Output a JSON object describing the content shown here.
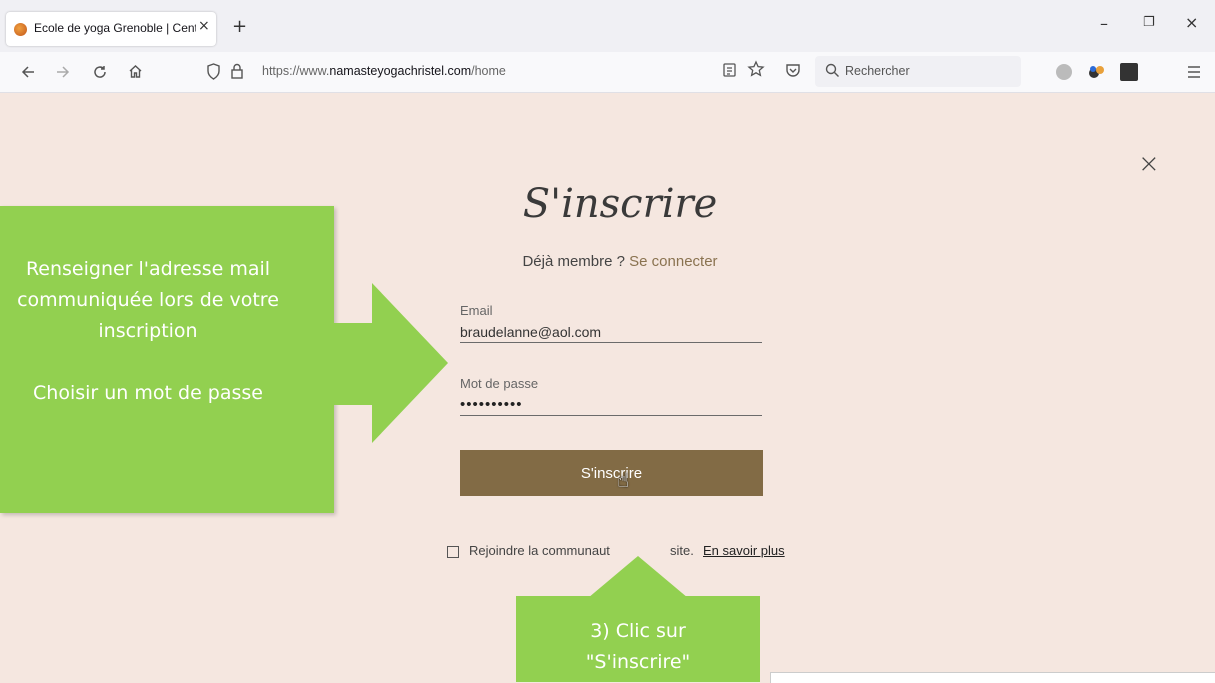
{
  "browser": {
    "tab_title": "Ecole de yoga Grenoble | Centr",
    "tab_close": "×",
    "new_tab": "+",
    "url_prefix": "https://www.",
    "url_domain": "namasteyogachristel.com",
    "url_path": "/home",
    "search_placeholder": "Rechercher",
    "win_min": "–",
    "win_max": "❐",
    "win_close": "×"
  },
  "nav_icons": [
    "back-icon",
    "forward-icon",
    "reload-icon",
    "home-icon"
  ],
  "page": {
    "close": "×",
    "heading": "S'inscrire",
    "already_member": "Déjà membre ?",
    "login_link": "Se connecter",
    "email_label": "Email",
    "email_value": "braudelanne@aol.com",
    "password_label": "Mot de passe",
    "password_value": "••••••••••",
    "submit_label": "S'inscrire",
    "community_text": "Rejoindre la communaut",
    "community_text_tail": "site.",
    "learn_more": "En savoir plus"
  },
  "callouts": {
    "left_lines": [
      "Renseigner l'adresse mail",
      "communiquée lors de votre",
      "inscription",
      "",
      "Choisir un mot de passe"
    ],
    "bottom_lines": [
      "3) Clic sur",
      "\"S'inscrire\""
    ]
  },
  "colors": {
    "page_bg": "#f5e7e0",
    "button": "#826b45",
    "callout": "#92d050",
    "link": "#8a7350"
  }
}
